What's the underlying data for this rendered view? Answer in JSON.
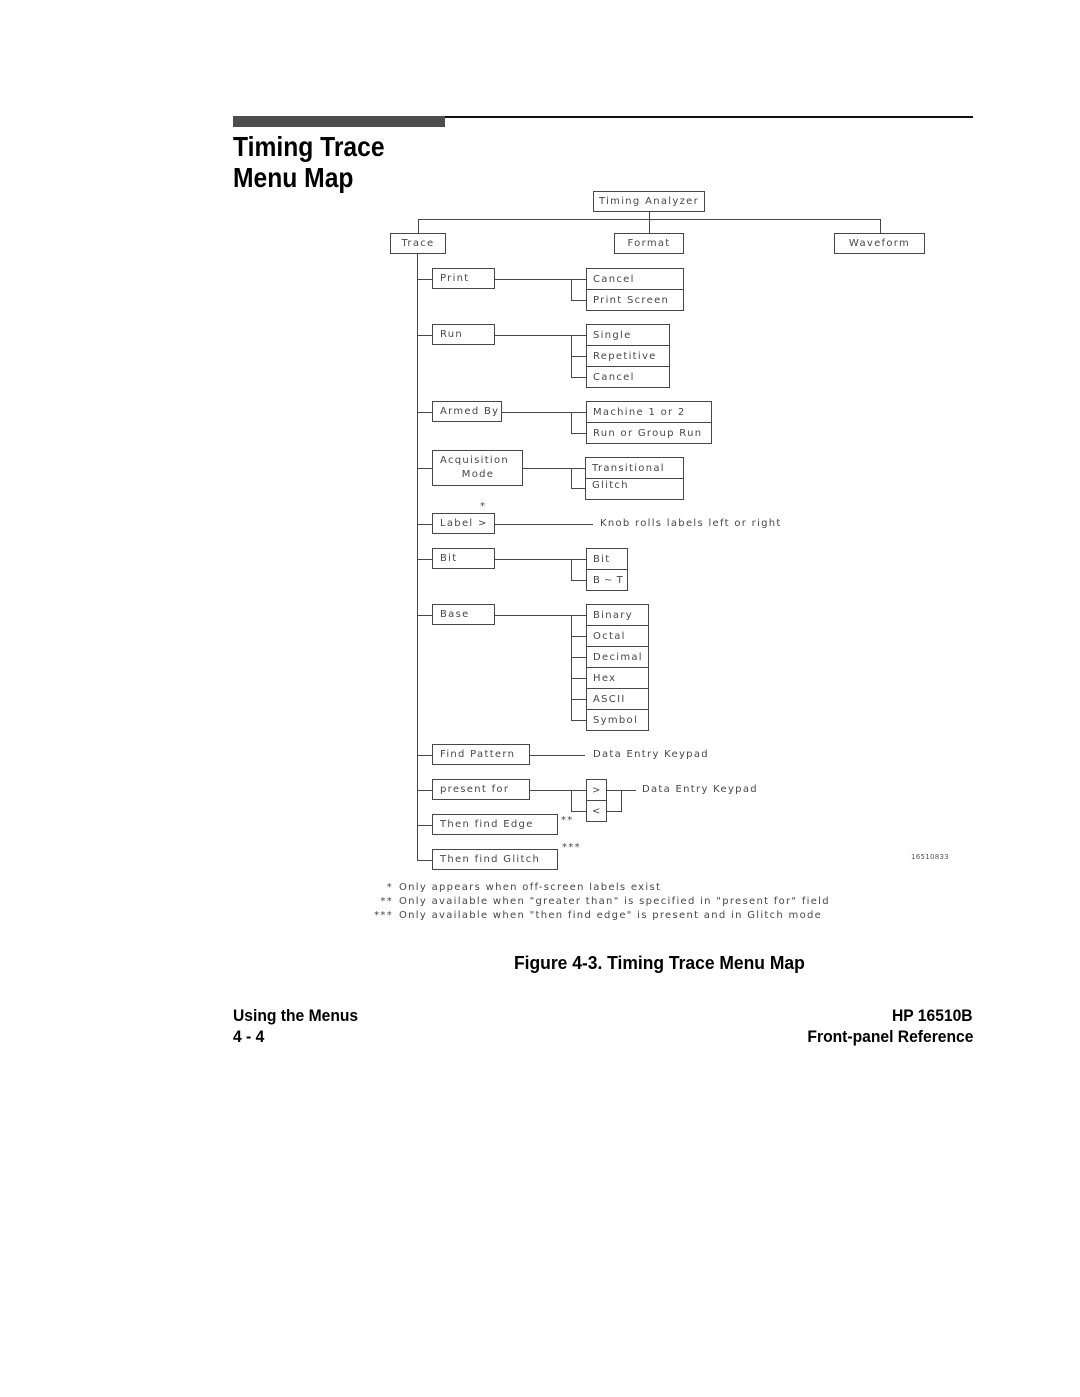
{
  "theme": {
    "header_bar": "#4d4d4d",
    "rule": "#111111",
    "diagram_ink": "#474747"
  },
  "header": {
    "title_line1": "Timing Trace",
    "title_line2": "Menu Map"
  },
  "diagram": {
    "root": "Timing Analyzer",
    "top_menus": [
      "Trace",
      "Format",
      "Waveform"
    ],
    "trace_items": [
      {
        "label": "Print",
        "options": [
          "Cancel",
          "Print Screen"
        ]
      },
      {
        "label": "Run",
        "options": [
          "Single",
          "Repetitive",
          "Cancel"
        ]
      },
      {
        "label": "Armed By",
        "options": [
          "Machine 1 or 2",
          "Run or Group Run"
        ]
      },
      {
        "label_line1": "Acquisition",
        "label_line2": "Mode",
        "options": [
          "Transitional",
          "Glitch"
        ]
      },
      {
        "label": "Label >",
        "marker": "*",
        "note": "Knob rolls labels left or right"
      },
      {
        "label": "Bit",
        "options": [
          "Bit",
          "B ∼ T"
        ]
      },
      {
        "label": "Base",
        "options": [
          "Binary",
          "Octal",
          "Decimal",
          "Hex",
          "ASCII",
          "Symbol"
        ]
      },
      {
        "label": "Find Pattern",
        "note": "Data Entry Keypad"
      },
      {
        "label": "present for",
        "options": [
          ">",
          "<"
        ],
        "note": "Data Entry Keypad"
      },
      {
        "label": "Then find Edge",
        "marker": "**"
      },
      {
        "label": "Then find Glitch",
        "marker": "***"
      }
    ],
    "figure_id": "16510833",
    "footnotes": [
      {
        "marker": "*",
        "text": "Only appears when off-screen labels exist"
      },
      {
        "marker": "**",
        "text": "Only available when \"greater than\" is specified in \"present for\" field"
      },
      {
        "marker": "***",
        "text": "Only available when \"then find edge\" is present and in Glitch mode"
      }
    ]
  },
  "caption": "Figure 4-3. Timing Trace Menu Map",
  "footer": {
    "section": "Using the Menus",
    "page_number": "4 - 4",
    "product": "HP 16510B",
    "manual": "Front-panel Reference"
  }
}
